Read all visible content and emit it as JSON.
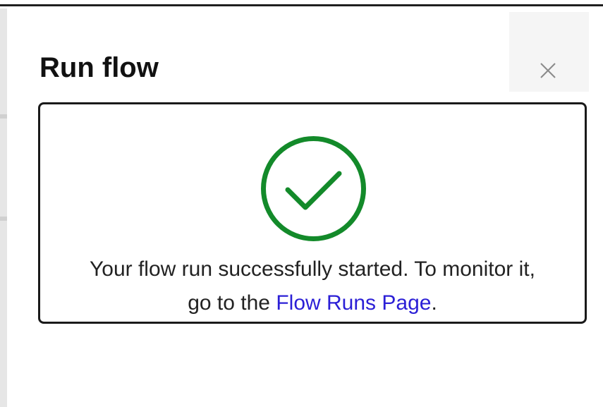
{
  "dialog": {
    "title": "Run flow",
    "close_icon": "close-icon"
  },
  "status": {
    "icon": "checkmark-circle-icon",
    "icon_color": "#138a2a",
    "message_line1": "Your flow run successfully started. To monitor it,",
    "message_prefix": "go to the ",
    "link_text": "Flow Runs Page",
    "message_suffix": ".",
    "link_color": "#2b1fd6"
  }
}
